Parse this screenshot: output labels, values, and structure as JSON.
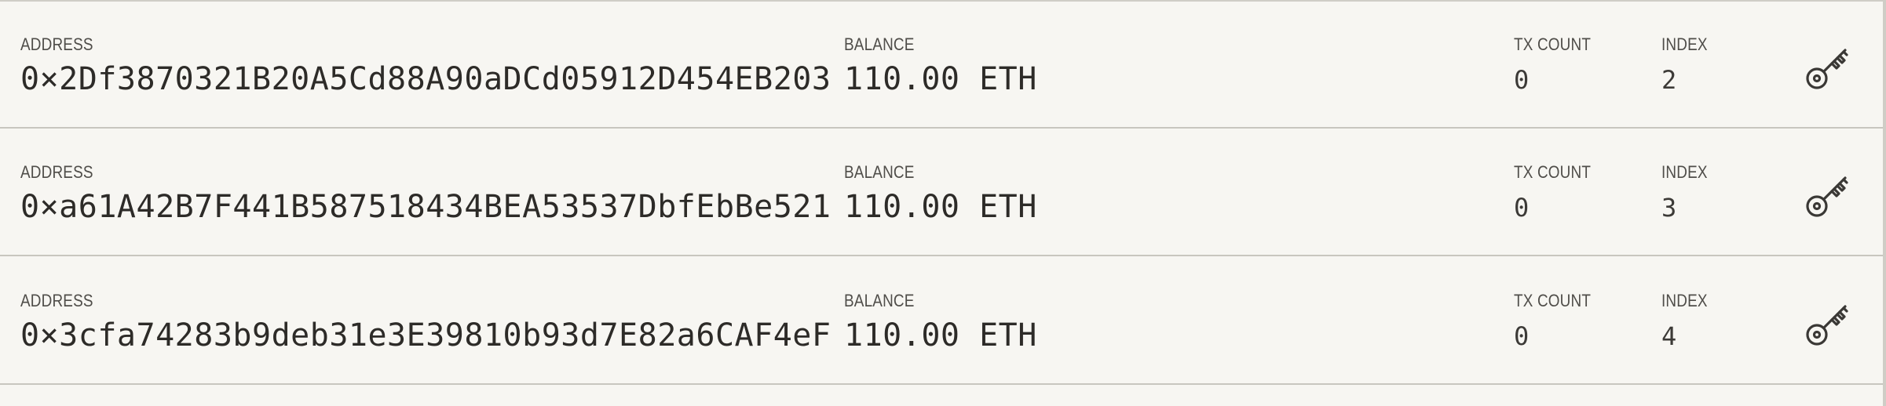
{
  "labels": {
    "address": "ADDRESS",
    "balance": "BALANCE",
    "tx_count": "TX COUNT",
    "index": "INDEX"
  },
  "accounts": [
    {
      "address": "0×2Df3870321B20A5Cd88A90aDCd05912D454EB203",
      "balance": "110.00 ETH",
      "tx_count": "0",
      "index": "2",
      "key_icon": "key-icon"
    },
    {
      "address": "0×a61A42B7F441B587518434BEA53537DbfEbBe521",
      "balance": "110.00 ETH",
      "tx_count": "0",
      "index": "3",
      "key_icon": "key-icon"
    },
    {
      "address": "0×3cfa74283b9deb31e3E39810b93d7E82a6CAF4eF",
      "balance": "110.00 ETH",
      "tx_count": "0",
      "index": "4",
      "key_icon": "key-icon"
    }
  ],
  "colors": {
    "background": "#f7f6f2",
    "divider": "#c8c6bf",
    "label_text": "#4f4d49",
    "value_text": "#2d2b28"
  }
}
